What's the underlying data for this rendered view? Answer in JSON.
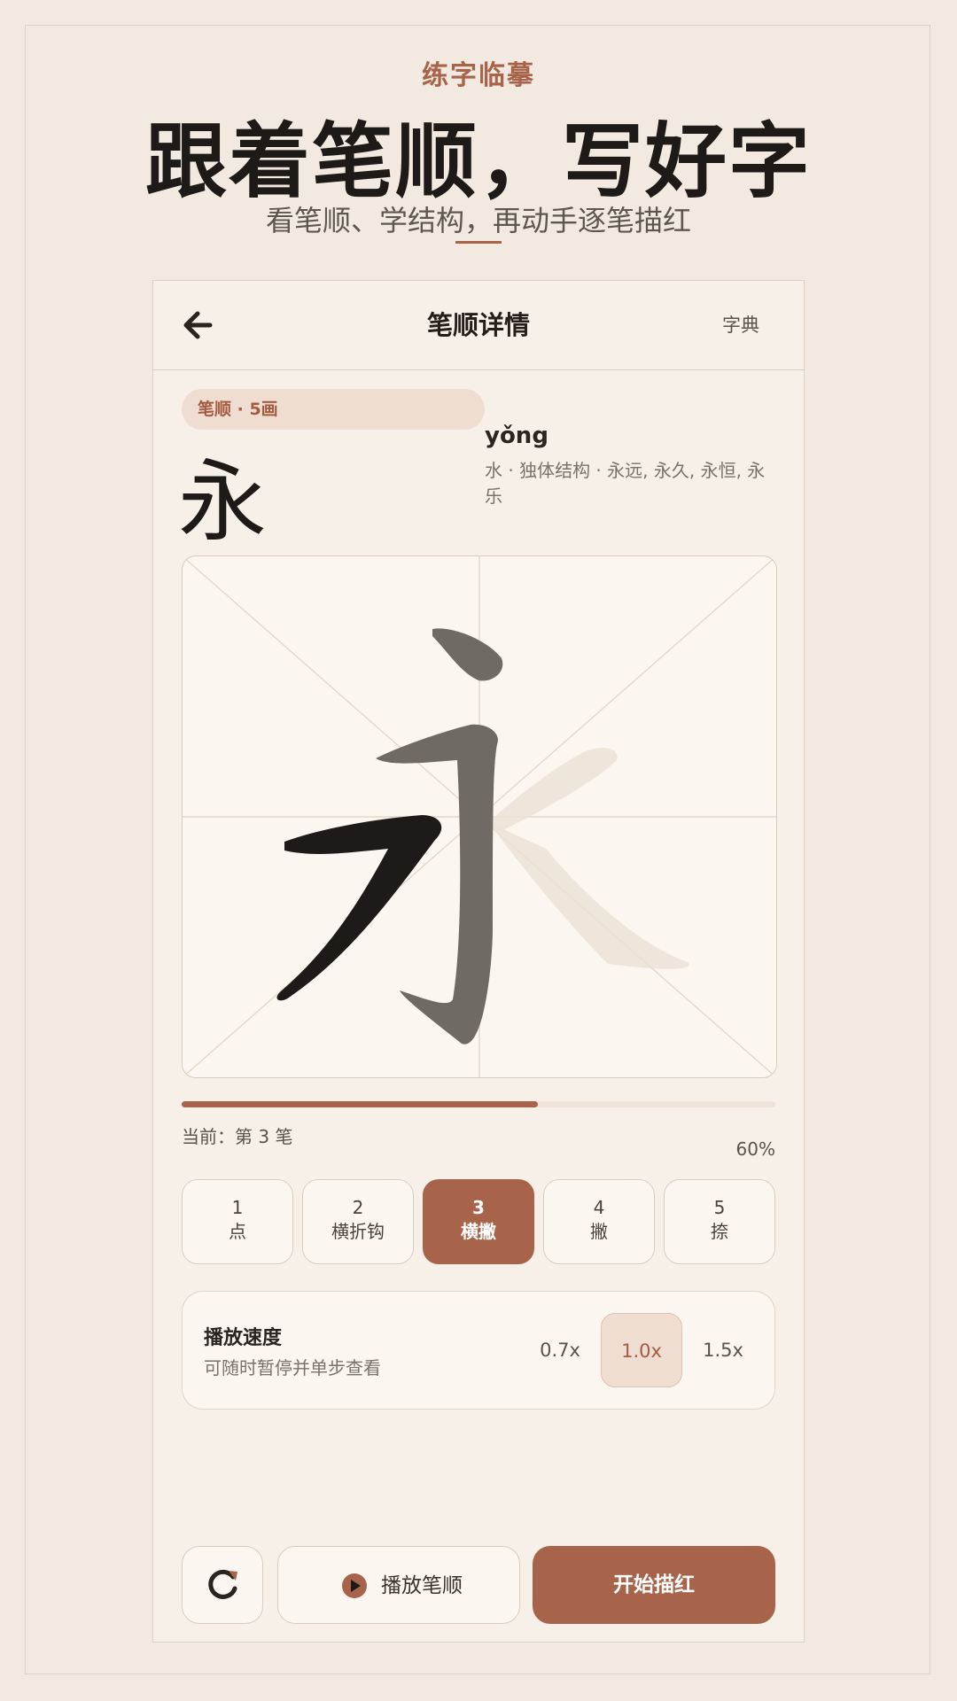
{
  "header": {
    "kicker": "练字临摹",
    "headline": "跟着笔顺，写好字",
    "subline": "看笔顺、学结构，再动手逐笔描红"
  },
  "nav": {
    "title": "笔顺详情",
    "dict_link": "字典"
  },
  "character": {
    "badge": "笔顺 · 5画",
    "glyph": "永",
    "pinyin": "yǒng",
    "meaning": "水 · 独体结构 · 永远, 永久, 永恒, 永乐"
  },
  "progress": {
    "current_label": "当前：第 3 笔",
    "percent_label": "60%",
    "fraction": 0.6
  },
  "strokes": [
    {
      "number": "1",
      "name": "点"
    },
    {
      "number": "2",
      "name": "横折钩"
    },
    {
      "number": "3",
      "name": "横撇"
    },
    {
      "number": "4",
      "name": "撇"
    },
    {
      "number": "5",
      "name": "捺"
    }
  ],
  "active_stroke_index": 2,
  "speed": {
    "title": "播放速度",
    "subtitle": "可随时暂停并单步查看",
    "options": [
      "0.7x",
      "1.0x",
      "1.5x"
    ],
    "selected_index": 1
  },
  "actions": {
    "play_label": "播放笔顺",
    "start_label": "开始描红"
  },
  "icons": {
    "back": "arrow-left-icon",
    "reset": "reset-icon",
    "play": "play-icon"
  },
  "colors": {
    "accent": "#a8644a",
    "background": "#f2e9e0",
    "panel": "#f7f0e8",
    "ink": "#1d1a17"
  }
}
